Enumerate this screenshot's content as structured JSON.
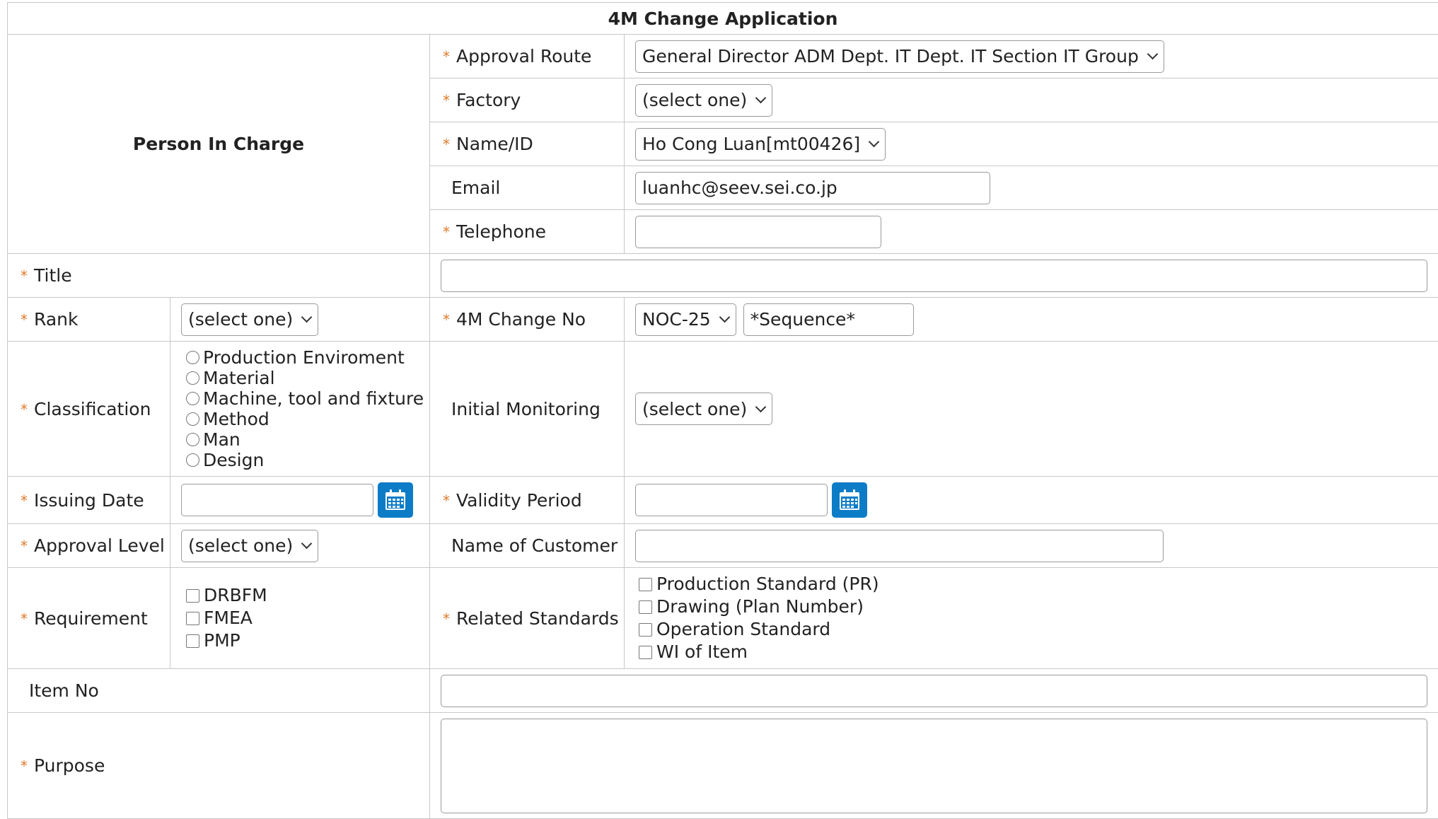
{
  "form_title": "4M Change Application",
  "person_in_charge": {
    "heading": "Person In Charge",
    "approval_route": {
      "label": "Approval Route",
      "value": "General Director ADM Dept. IT Dept. IT Section IT Group"
    },
    "factory": {
      "label": "Factory",
      "value": "(select one)"
    },
    "name_id": {
      "label": "Name/ID",
      "value": "Ho Cong Luan[mt00426]"
    },
    "email": {
      "label": "Email",
      "value": "luanhc@seev.sei.co.jp"
    },
    "telephone": {
      "label": "Telephone",
      "value": ""
    }
  },
  "title": {
    "label": "Title",
    "value": ""
  },
  "rank": {
    "label": "Rank",
    "value": "(select one)"
  },
  "change_no": {
    "label": "4M Change No",
    "prefix": "NOC-25",
    "sequence": "*Sequence*"
  },
  "classification": {
    "label": "Classification",
    "options": [
      "Production Enviroment",
      "Material",
      "Machine, tool and fixture",
      "Method",
      "Man",
      "Design"
    ]
  },
  "initial_monitoring": {
    "label": "Initial Monitoring",
    "value": "(select one)"
  },
  "issuing_date": {
    "label": "Issuing Date",
    "value": ""
  },
  "validity_period": {
    "label": "Validity Period",
    "value": ""
  },
  "approval_level": {
    "label": "Approval Level",
    "value": "(select one)"
  },
  "customer_name": {
    "label": "Name of Customer",
    "value": ""
  },
  "requirement": {
    "label": "Requirement",
    "options": [
      "DRBFM",
      "FMEA",
      "PMP"
    ]
  },
  "related_standards": {
    "label": "Related Standards",
    "options": [
      "Production Standard (PR)",
      "Drawing (Plan Number)",
      "Operation Standard",
      "WI of Item"
    ]
  },
  "item_no": {
    "label": "Item No",
    "value": ""
  },
  "purpose": {
    "label": "Purpose",
    "value": ""
  },
  "required_marker": "*",
  "colors": {
    "required_star": "#e07a2a",
    "calendar_button": "#0d7cc7",
    "border": "#c8c8c8"
  },
  "icons": {
    "calendar": "calendar-icon",
    "dropdown": "chevron-down-icon"
  }
}
